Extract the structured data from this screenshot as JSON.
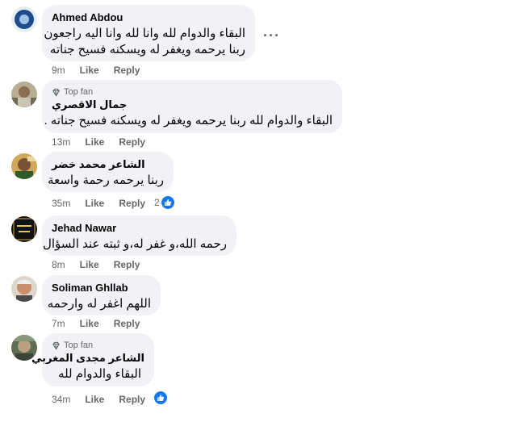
{
  "comments": [
    {
      "name": "Ahmed Abdou",
      "top_fan": false,
      "text_lines": [
        "البقاء والدوام لله وانا لله وانا اليه راجعون",
        "ربنا يرحمه ويغفر له ويسكنه فسيح جناته"
      ],
      "time": "9m",
      "like_label": "Like",
      "reply_label": "Reply",
      "more_label": "···"
    },
    {
      "name": "جمال الاقصري",
      "top_fan": true,
      "badge_label": "Top fan",
      "text_lines": [
        "البقاء والدوام لله ربنا يرحمه ويغفر له ويسكنه فسيح جناته ."
      ],
      "time": "13m",
      "like_label": "Like",
      "reply_label": "Reply"
    },
    {
      "name": "الشاعر محمد خضر",
      "top_fan": false,
      "text_lines": [
        "ربنا يرحمه رحمة واسعة"
      ],
      "time": "35m",
      "like_label": "Like",
      "reply_label": "Reply",
      "reaction_count": "2"
    },
    {
      "name": "Jehad Nawar",
      "top_fan": false,
      "text_lines": [
        "رحمه الله،و غفر له،و ثبته عند السؤال"
      ],
      "time": "8m",
      "like_label": "Like",
      "reply_label": "Reply",
      "avatar_text": [
        "لا إله إلا الله",
        "إنا لله وإنا إليه راجعون"
      ]
    },
    {
      "name": "Soliman Ghllab",
      "top_fan": false,
      "text_lines": [
        "اللهم اغفر له وارحمه"
      ],
      "time": "7m",
      "like_label": "Like",
      "reply_label": "Reply"
    },
    {
      "name": "الشاعر مجدى المغربي",
      "top_fan": true,
      "badge_label": "Top fan",
      "text_lines": [
        "البقاء والدوام لله"
      ],
      "time": "34m",
      "like_label": "Like",
      "reply_label": "Reply",
      "reaction_count": ""
    }
  ],
  "colors": {
    "bubble": "#f0f2f5",
    "secondary_text": "#65676b",
    "like_blue": "#1877f2"
  }
}
